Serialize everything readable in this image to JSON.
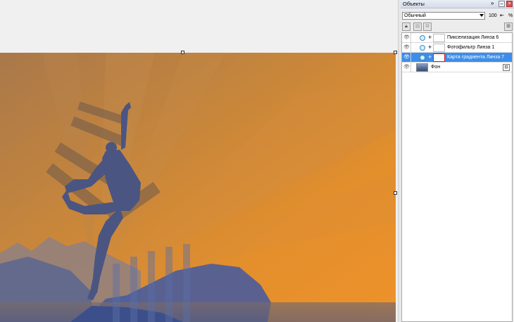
{
  "panel": {
    "title": "Объекты",
    "expand_glyph": "»",
    "minimize_glyph": "–",
    "close_glyph": "×"
  },
  "blend": {
    "mode": "Обычный",
    "opacity": "100",
    "percent": "%"
  },
  "layers": [
    {
      "name": "Пикселизация Линза 6",
      "type": "lens",
      "selected": false
    },
    {
      "name": "Фотофильтр Линза 1",
      "type": "lens",
      "selected": false
    },
    {
      "name": "Карта градиента Линза 7",
      "type": "lens",
      "selected": true
    },
    {
      "name": "Фон",
      "type": "background",
      "selected": false
    }
  ],
  "colors": {
    "selection": "#3d8ee8",
    "canvas_orange": "#ec912a",
    "canvas_blue": "#3f5a9a"
  }
}
